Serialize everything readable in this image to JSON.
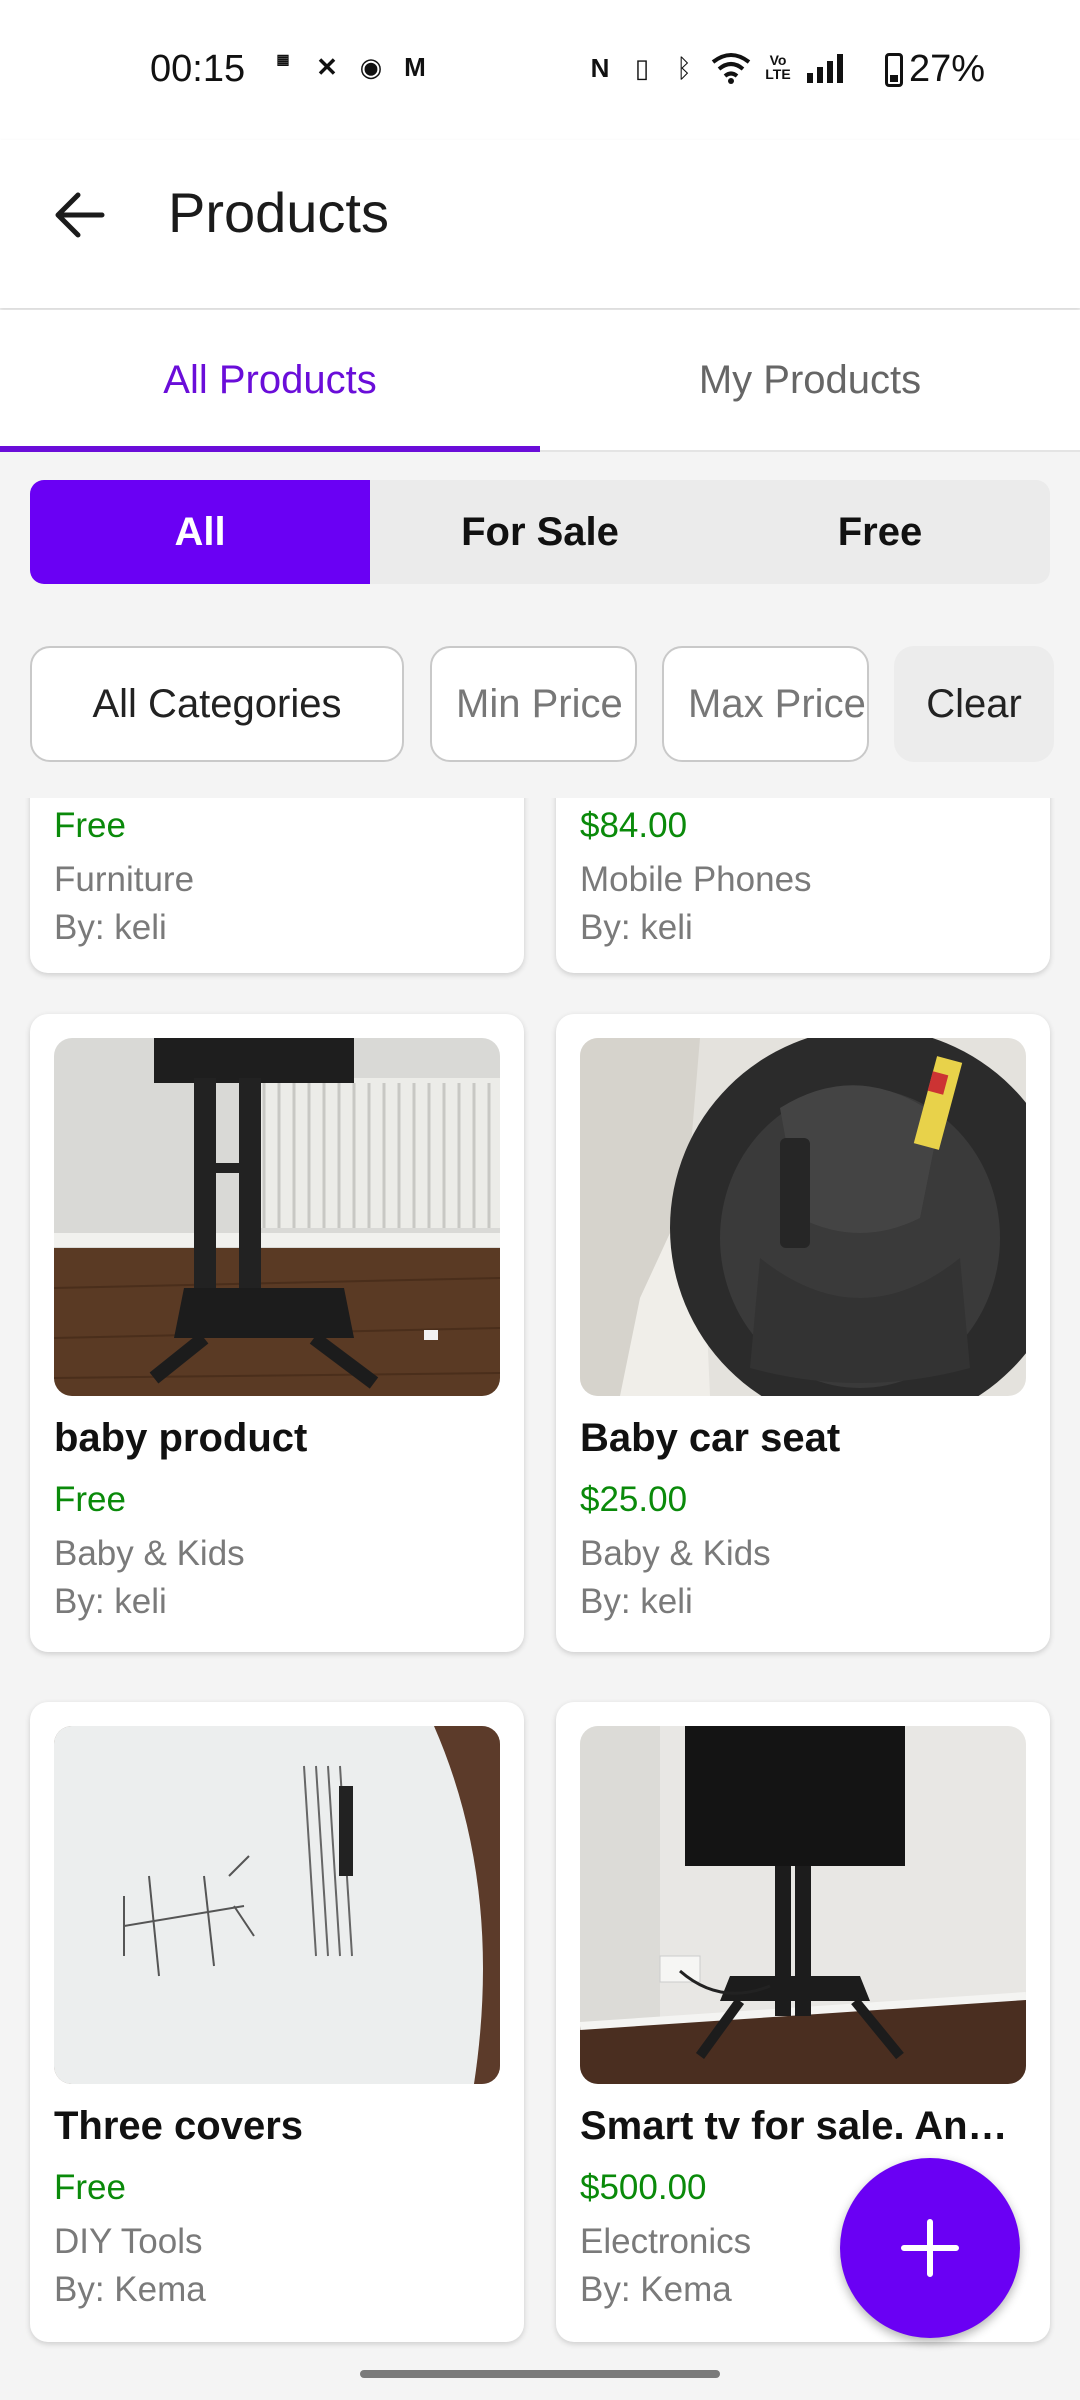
{
  "status_bar": {
    "time": "00:15",
    "left_icons": [
      "temu-icon",
      "x-icon",
      "app-icon",
      "gmail-icon"
    ],
    "right_icons": [
      "nfc-icon",
      "vibrate-icon",
      "bluetooth-icon",
      "wifi-icon",
      "volte-icon",
      "signal-icon"
    ],
    "battery": "27%"
  },
  "app_bar": {
    "title": "Products",
    "back_icon": "arrow-left-icon"
  },
  "tabs": [
    {
      "label": "All Products",
      "active": true
    },
    {
      "label": "My Products",
      "active": false
    }
  ],
  "filter_segments": [
    {
      "label": "All",
      "active": true
    },
    {
      "label": "For Sale",
      "active": false
    },
    {
      "label": "Free",
      "active": false
    }
  ],
  "filters": {
    "category": "All Categories",
    "min_price_placeholder": "Min Price",
    "max_price_placeholder": "Max Price",
    "clear_label": "Clear"
  },
  "products": [
    {
      "name": "",
      "price": "Free",
      "category": "Furniture",
      "seller": "By: keli"
    },
    {
      "name": "",
      "price": "$84.00",
      "category": "Mobile Phones",
      "seller": "By: keli"
    },
    {
      "name": "baby product",
      "price": "Free",
      "category": "Baby & Kids",
      "seller": "By: keli",
      "image": "tv-stand-photo"
    },
    {
      "name": "Baby car seat",
      "price": "$25.00",
      "category": "Baby & Kids",
      "seller": "By: keli",
      "image": "car-seat-photo"
    },
    {
      "name": "Three covers",
      "price": "Free",
      "category": "DIY Tools",
      "seller": "By: Kema",
      "image": "manual-photo"
    },
    {
      "name": "Smart tv for sale. And tv stand",
      "price": "$500.00",
      "category": "Electronics",
      "seller": "By: Kema",
      "image": "tv-photo"
    }
  ],
  "fab": {
    "icon": "plus-icon"
  },
  "colors": {
    "accent": "#6a00f4",
    "price_green": "#0a8a0a"
  }
}
